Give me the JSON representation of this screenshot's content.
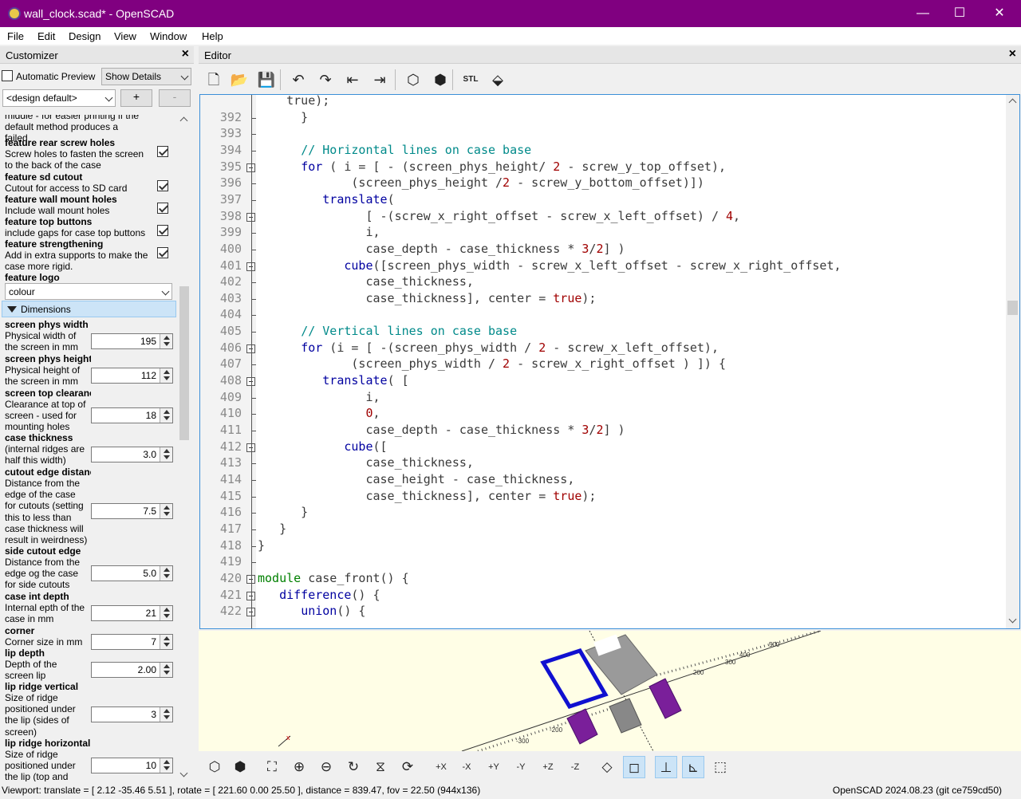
{
  "window": {
    "title": "wall_clock.scad* - OpenSCAD",
    "min": "—",
    "max": "☐",
    "close": "✕"
  },
  "menu": [
    "File",
    "Edit",
    "Design",
    "View",
    "Window",
    "Help"
  ],
  "customizer": {
    "title": "Customizer",
    "auto_preview_label": "Automatic Preview",
    "auto_preview_checked": false,
    "details_combo": "Show Details",
    "preset_combo": "<design default>",
    "add_label": "+",
    "remove_label": "-",
    "top_partial": "middle - for easier printing if the default method produces a failed",
    "feature_params": [
      {
        "name": "feature rear screw holes",
        "desc": [
          "Screw holes to fasten the screen",
          "to the back of the case"
        ],
        "checked": true
      },
      {
        "name": "feature sd cutout",
        "desc": [
          "Cutout for access to SD card"
        ],
        "checked": true
      },
      {
        "name": "feature wall mount holes",
        "desc": [
          "Include wall mount holes"
        ],
        "checked": true
      },
      {
        "name": "feature top buttons",
        "desc": [
          "include gaps for case top buttons"
        ],
        "checked": true
      },
      {
        "name": "feature strengthening",
        "desc": [
          "Add in extra supports to make the",
          "case more rigid."
        ],
        "checked": true
      }
    ],
    "logo": {
      "name": "feature logo",
      "value": "colour"
    },
    "section_label": "Dimensions",
    "dims": [
      {
        "name": "screen phys width",
        "desc": [
          "Physical width of",
          "the screen in mm"
        ],
        "value": "195"
      },
      {
        "name": "screen phys height",
        "desc": [
          "Physical height of",
          "the screen in mm"
        ],
        "value": "112"
      },
      {
        "name": "screen top clearance",
        "desc": [
          "Clearance at top of",
          "screen - used for",
          "mounting holes"
        ],
        "value": "18"
      },
      {
        "name": "case thickness",
        "desc": [
          "(internal ridges are",
          "half this width)"
        ],
        "value": "3.0"
      },
      {
        "name": "cutout edge distance",
        "desc": [
          "Distance from the",
          "edge of the case",
          "for cutouts (setting",
          "this to less than",
          "case thickness will",
          "result in weirdness)"
        ],
        "value": "7.5"
      },
      {
        "name": "side cutout edge",
        "desc": [
          "Distance from the",
          "edge og the case",
          "for side cutouts"
        ],
        "value": "5.0"
      },
      {
        "name": "case int depth",
        "desc": [
          "Internal epth of the",
          "case in mm"
        ],
        "value": "21"
      },
      {
        "name": "corner",
        "desc": [
          "Corner size in mm"
        ],
        "value": "7"
      },
      {
        "name": "lip depth",
        "desc": [
          "Depth of the",
          "screen lip"
        ],
        "value": "2.00"
      },
      {
        "name": "lip ridge vertical",
        "desc": [
          "Size of ridge",
          "positioned under",
          "the lip (sides of",
          "screen)"
        ],
        "value": "3"
      },
      {
        "name": "lip ridge horizontal",
        "desc": [
          "Size of ridge",
          "positioned under",
          "the lip (top and"
        ],
        "value": "10"
      }
    ]
  },
  "editor": {
    "title": "Editor",
    "toolbar": [
      {
        "name": "new-file-icon",
        "g": "🗋"
      },
      {
        "name": "open-file-icon",
        "g": "📂"
      },
      {
        "name": "save-icon",
        "g": "💾"
      },
      {
        "name": "undo-icon",
        "g": "↶"
      },
      {
        "name": "redo-icon",
        "g": "↷"
      },
      {
        "name": "unindent-icon",
        "g": "⇤"
      },
      {
        "name": "indent-icon",
        "g": "⇥"
      },
      {
        "name": "preview-icon",
        "g": "⬡"
      },
      {
        "name": "render-icon",
        "g": "⬢"
      },
      {
        "name": "export-stl-icon",
        "g": "STL"
      },
      {
        "name": "send-to-print-icon",
        "g": "⬙"
      }
    ],
    "lines": [
      {
        "n": "",
        "fold": false,
        "t": [
          [
            "    true",
            ""
          ],
          [
            ");",
            ""
          ]
        ]
      },
      {
        "n": "392",
        "fold": false,
        "t": [
          [
            "      }",
            ""
          ]
        ]
      },
      {
        "n": "393",
        "fold": false,
        "t": [
          [
            "",
            ""
          ]
        ]
      },
      {
        "n": "394",
        "fold": false,
        "t": [
          [
            "      ",
            ""
          ],
          [
            "// Horizontal lines on case base",
            "c"
          ]
        ]
      },
      {
        "n": "395",
        "fold": true,
        "t": [
          [
            "      ",
            ""
          ],
          [
            "for",
            "k"
          ],
          [
            " ( i = [ - (screen_phys_height/ ",
            ""
          ],
          [
            "2",
            "n"
          ],
          [
            " - screw_y_top_offset),",
            ""
          ]
        ]
      },
      {
        "n": "396",
        "fold": false,
        "t": [
          [
            "             (screen_phys_height /",
            ""
          ],
          [
            "2",
            "n"
          ],
          [
            " - screw_y_bottom_offset)])",
            ""
          ]
        ]
      },
      {
        "n": "397",
        "fold": false,
        "t": [
          [
            "         ",
            ""
          ],
          [
            "translate",
            "k"
          ],
          [
            "(",
            ""
          ]
        ]
      },
      {
        "n": "398",
        "fold": true,
        "t": [
          [
            "               [ -(screw_x_right_offset - screw_x_left_offset) / ",
            ""
          ],
          [
            "4",
            "n"
          ],
          [
            ",",
            ""
          ]
        ]
      },
      {
        "n": "399",
        "fold": false,
        "t": [
          [
            "               i,",
            ""
          ]
        ]
      },
      {
        "n": "400",
        "fold": false,
        "t": [
          [
            "               case_depth - case_thickness * ",
            ""
          ],
          [
            "3",
            "n"
          ],
          [
            "/",
            ""
          ],
          [
            "2",
            "n"
          ],
          [
            "] )",
            ""
          ]
        ]
      },
      {
        "n": "401",
        "fold": true,
        "t": [
          [
            "            ",
            ""
          ],
          [
            "cube",
            "k"
          ],
          [
            "([screen_phys_width - screw_x_left_offset - screw_x_right_offset,",
            ""
          ]
        ]
      },
      {
        "n": "402",
        "fold": false,
        "t": [
          [
            "               case_thickness,",
            ""
          ]
        ]
      },
      {
        "n": "403",
        "fold": false,
        "t": [
          [
            "               case_thickness], center = ",
            ""
          ],
          [
            "true",
            "b"
          ],
          [
            ");",
            ""
          ]
        ]
      },
      {
        "n": "404",
        "fold": false,
        "t": [
          [
            "",
            ""
          ]
        ]
      },
      {
        "n": "405",
        "fold": false,
        "t": [
          [
            "      ",
            ""
          ],
          [
            "// Vertical lines on case base",
            "c"
          ]
        ]
      },
      {
        "n": "406",
        "fold": true,
        "t": [
          [
            "      ",
            ""
          ],
          [
            "for",
            "k"
          ],
          [
            " (i = [ -(screen_phys_width / ",
            ""
          ],
          [
            "2",
            "n"
          ],
          [
            " - screw_x_left_offset),",
            ""
          ]
        ]
      },
      {
        "n": "407",
        "fold": false,
        "t": [
          [
            "             (screen_phys_width / ",
            ""
          ],
          [
            "2",
            "n"
          ],
          [
            " - screw_x_right_offset ) ]) {",
            ""
          ]
        ]
      },
      {
        "n": "408",
        "fold": true,
        "t": [
          [
            "         ",
            ""
          ],
          [
            "translate",
            "k"
          ],
          [
            "( [",
            ""
          ]
        ]
      },
      {
        "n": "409",
        "fold": false,
        "t": [
          [
            "               i,",
            ""
          ]
        ]
      },
      {
        "n": "410",
        "fold": false,
        "t": [
          [
            "               ",
            ""
          ],
          [
            "0",
            "n"
          ],
          [
            ",",
            ""
          ]
        ]
      },
      {
        "n": "411",
        "fold": false,
        "t": [
          [
            "               case_depth - case_thickness * ",
            ""
          ],
          [
            "3",
            "n"
          ],
          [
            "/",
            ""
          ],
          [
            "2",
            "n"
          ],
          [
            "] )",
            ""
          ]
        ]
      },
      {
        "n": "412",
        "fold": true,
        "t": [
          [
            "            ",
            ""
          ],
          [
            "cube",
            "k"
          ],
          [
            "([",
            ""
          ]
        ]
      },
      {
        "n": "413",
        "fold": false,
        "t": [
          [
            "               case_thickness,",
            ""
          ]
        ]
      },
      {
        "n": "414",
        "fold": false,
        "t": [
          [
            "               case_height - case_thickness,",
            ""
          ]
        ]
      },
      {
        "n": "415",
        "fold": false,
        "t": [
          [
            "               case_thickness], center = ",
            ""
          ],
          [
            "true",
            "b"
          ],
          [
            ");",
            ""
          ]
        ]
      },
      {
        "n": "416",
        "fold": false,
        "t": [
          [
            "      }",
            ""
          ]
        ]
      },
      {
        "n": "417",
        "fold": false,
        "t": [
          [
            "   }",
            ""
          ]
        ]
      },
      {
        "n": "418",
        "fold": false,
        "t": [
          [
            "}",
            ""
          ]
        ]
      },
      {
        "n": "419",
        "fold": false,
        "t": [
          [
            "",
            ""
          ]
        ]
      },
      {
        "n": "420",
        "fold": true,
        "t": [
          [
            "module",
            "g"
          ],
          [
            " case_front() {",
            ""
          ]
        ]
      },
      {
        "n": "421",
        "fold": true,
        "t": [
          [
            "   ",
            ""
          ],
          [
            "difference",
            "k"
          ],
          [
            "() {",
            ""
          ]
        ]
      },
      {
        "n": "422",
        "fold": true,
        "t": [
          [
            "      ",
            ""
          ],
          [
            "union",
            "k"
          ],
          [
            "() {",
            ""
          ]
        ]
      }
    ]
  },
  "viewbar": [
    {
      "name": "preview-view-icon",
      "g": "⬡"
    },
    {
      "name": "render-view-icon",
      "g": "⬢"
    },
    {
      "name": "view-all-icon",
      "g": "⛶"
    },
    {
      "name": "zoom-in-icon",
      "g": "⊕"
    },
    {
      "name": "zoom-out-icon",
      "g": "⊖"
    },
    {
      "name": "reset-view-icon",
      "g": "↻"
    },
    {
      "name": "view-center-icon",
      "g": "⧖"
    },
    {
      "name": "animate-icon",
      "g": "⟳"
    },
    {
      "name": "view-right-icon",
      "g": "+X"
    },
    {
      "name": "view-left-icon",
      "g": "-X"
    },
    {
      "name": "view-back-icon",
      "g": "+Y"
    },
    {
      "name": "view-front-icon",
      "g": "-Y"
    },
    {
      "name": "view-top-icon",
      "g": "+Z"
    },
    {
      "name": "view-bottom-icon",
      "g": "-Z"
    },
    {
      "name": "perspective-icon",
      "g": "◇"
    },
    {
      "name": "orthogonal-icon",
      "g": "◻"
    },
    {
      "name": "show-axes-icon",
      "g": "⊥"
    },
    {
      "name": "show-scale-icon",
      "g": "⊾"
    },
    {
      "name": "show-edges-icon",
      "g": "⬚"
    }
  ],
  "status": {
    "left": "Viewport: translate = [ 2.12 -35.46 5.51 ], rotate = [ 221.60 0.00 25.50 ], distance = 839.47, fov = 22.50 (944x136)",
    "right": "OpenSCAD 2024.08.23 (git ce759cd50)"
  },
  "preview_labels": {
    "p1": "-300",
    "p2": "-200",
    "p3": "200",
    "p4": "300",
    "p5": "400",
    "p6": "500",
    "x": "x"
  }
}
